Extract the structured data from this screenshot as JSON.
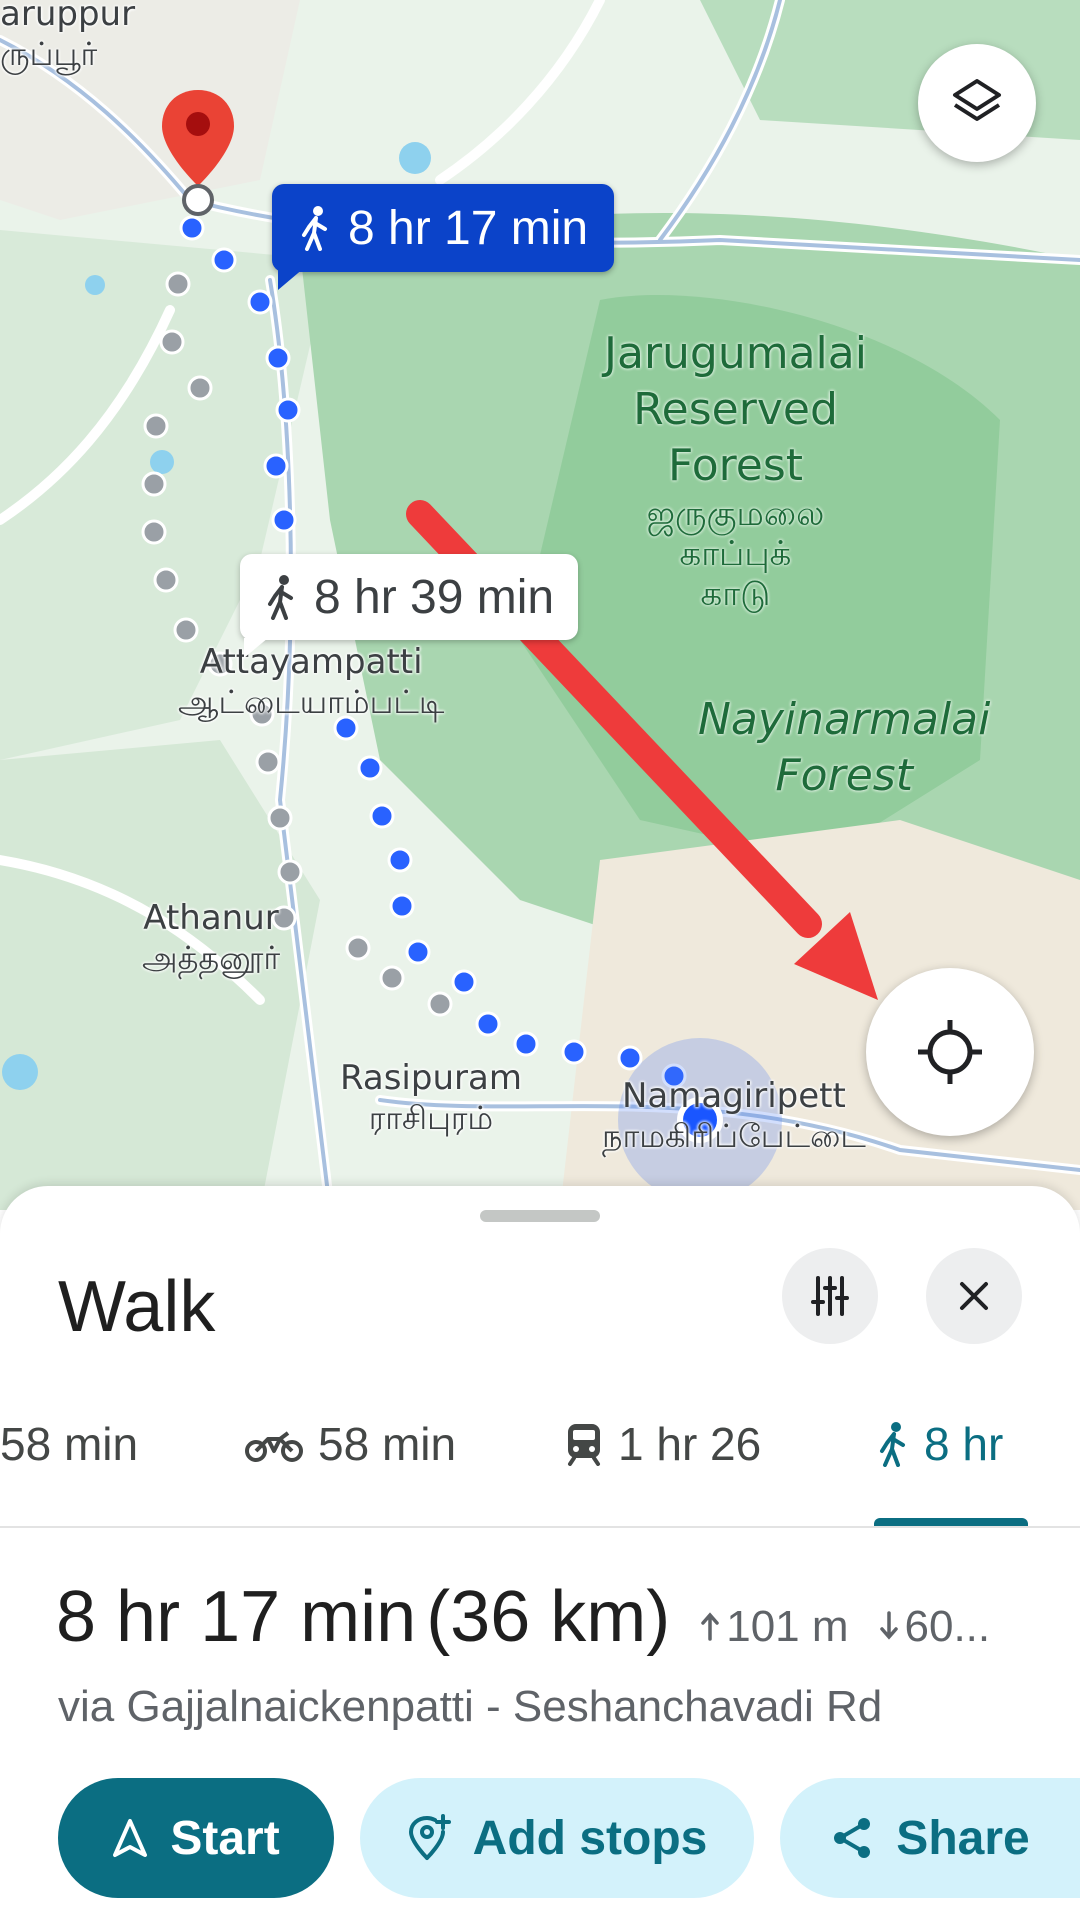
{
  "map": {
    "labels": {
      "aruppur_en": "aruppur",
      "aruppur_ta": "ருப்பூர்",
      "jarugumalai_line1": "Jarugumalai",
      "jarugumalai_line2": "Reserved",
      "jarugumalai_line3": "Forest",
      "jarugumalai_ta1": "ஜருகுமலை",
      "jarugumalai_ta2": "காப்புக்",
      "jarugumalai_ta3": "காடு",
      "nayinarmalai_line1": "Nayinarmalai",
      "nayinarmalai_line2": "Forest",
      "attayampatti_en": "Attayampatti",
      "attayampatti_ta": "ஆட்டையாம்பட்டி",
      "athanur_en": "Athanur",
      "athanur_ta": "அத்தனூர்",
      "rasipuram_en": "Rasipuram",
      "rasipuram_ta": "ராசிபுரம்",
      "namagiripet_en": "Namagiripett",
      "namagiripet_ta": "நாமகிரிப்பேட்டை"
    },
    "primary_route_time": "8 hr 17 min",
    "alt_route_time": "8 hr 39 min",
    "icons": {
      "destination": "destination-pin-icon",
      "layers": "layers-icon",
      "locate": "my-location-icon",
      "walk": "walk-icon"
    },
    "colors": {
      "primary_route": "#2962ff",
      "alt_route": "#9aa0a6",
      "pin": "#ea4335",
      "annotation_arrow": "#ee3b3b"
    }
  },
  "sheet": {
    "title": "Walk",
    "modes": [
      {
        "label": "58 min",
        "icon": "car-icon",
        "active": false
      },
      {
        "label": "58 min",
        "icon": "motorcycle-icon",
        "active": false
      },
      {
        "label": "1 hr 26",
        "icon": "transit-icon",
        "active": false
      },
      {
        "label": "8 hr",
        "icon": "walk-icon",
        "active": true
      }
    ],
    "route": {
      "time": "8 hr 17 min",
      "distance": "(36 km)",
      "ascent": "101 m",
      "descent": "60..."
    },
    "via": "via Gajjalnaickenpatti - Seshanchavadi Rd",
    "buttons": {
      "start": "Start",
      "add_stops": "Add stops",
      "share": "Share"
    },
    "accent_color": "#0b6e82"
  }
}
